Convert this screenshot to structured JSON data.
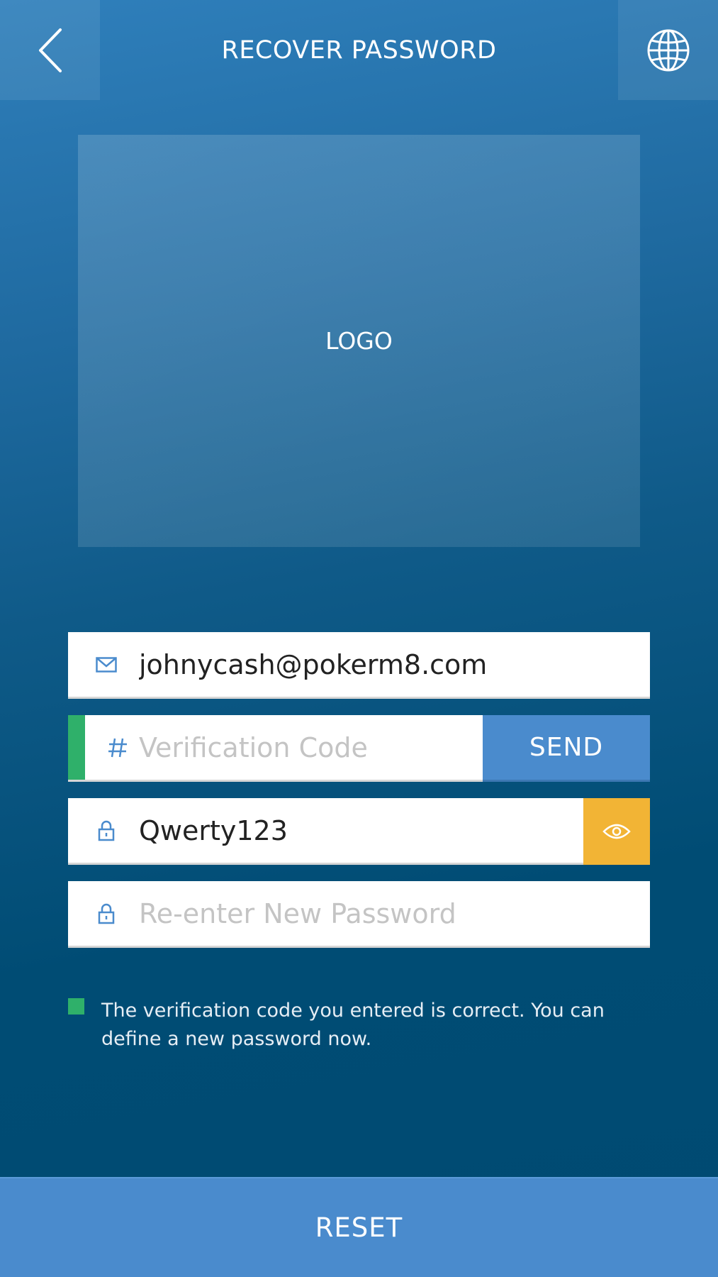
{
  "header": {
    "title": "RECOVER PASSWORD",
    "back_icon": "chevron-left-icon",
    "language_icon": "globe-icon"
  },
  "logo": {
    "label": "LOGO"
  },
  "form": {
    "email": {
      "value": "johnycash@pokerm8.com",
      "icon": "envelope-icon"
    },
    "verification": {
      "placeholder": "Verification Code",
      "icon": "hash-icon",
      "send_label": "SEND"
    },
    "new_password": {
      "value": "Qwerty123",
      "icon": "lock-icon",
      "toggle_icon": "eye-icon"
    },
    "confirm_password": {
      "placeholder": "Re-enter New Password",
      "icon": "lock-icon"
    }
  },
  "status": {
    "message": "The verification code you entered is correct. You can define a new password now."
  },
  "footer": {
    "reset_label": "RESET"
  },
  "colors": {
    "accent_blue": "#4a8bcd",
    "success_green": "#2fb06a",
    "eye_toggle": "#f2b435",
    "icon_blue": "#4a8bcd"
  }
}
